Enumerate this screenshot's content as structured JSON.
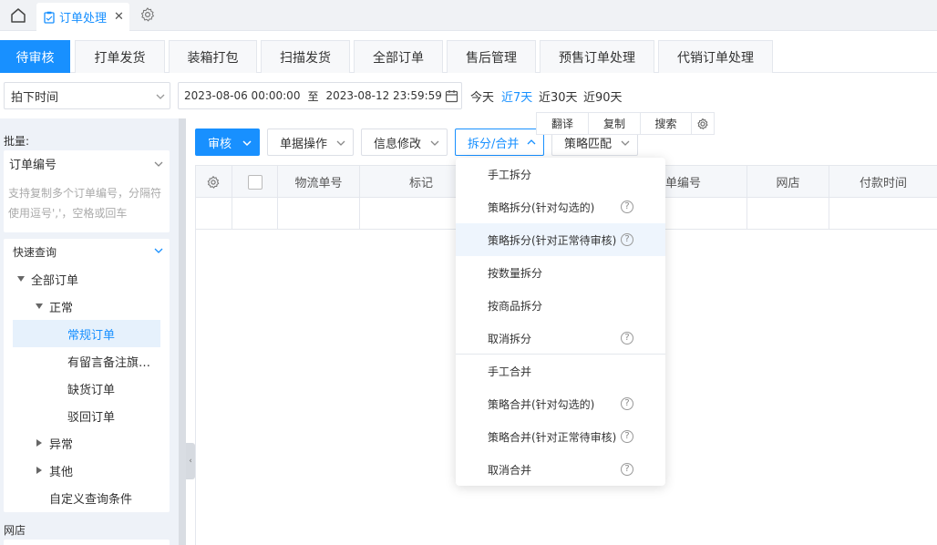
{
  "topbar": {
    "tab_title": "订单处理",
    "close_glyph": "✕"
  },
  "main_tabs": [
    "待审核",
    "打单发货",
    "装箱打包",
    "扫描发货",
    "全部订单",
    "售后管理",
    "预售订单处理",
    "代销订单处理"
  ],
  "filter": {
    "time_type": "拍下时间",
    "date_start": "2023-08-06 00:00:00",
    "date_sep": "至",
    "date_end": "2023-08-12 23:59:59",
    "quick_ranges": [
      "今天",
      "近7天",
      "近30天",
      "近90天"
    ],
    "active_quick_range": "近7天"
  },
  "left_panel": {
    "batch_label": "批量:",
    "batch_field": "订单编号",
    "batch_placeholder_line1": "支持复制多个订单编号，分隔符",
    "batch_placeholder_line2": "使用逗号','，空格或回车",
    "quick_query_title": "快速查询",
    "tree": {
      "all": "全部订单",
      "normal": "正常",
      "regular": "常规订单",
      "with_remarks": "有留言备注旗…",
      "out_of_stock": "缺货订单",
      "rejected": "驳回订单",
      "abnormal": "异常",
      "other": "其他",
      "custom_query": "自定义查询条件"
    },
    "shop_label": "网店"
  },
  "toolbar": {
    "audit": "审核",
    "single_ops": "单据操作",
    "info_edit": "信息修改",
    "split_merge": "拆分/合并",
    "strategy_match": "策略匹配"
  },
  "float_bar": {
    "translate": "翻译",
    "copy": "复制",
    "search": "搜索"
  },
  "table": {
    "headers": [
      "物流单号",
      "标记",
      "订单编号",
      "网店",
      "付款时间"
    ],
    "order_no_visible": "单编号"
  },
  "dropdown": {
    "items": [
      {
        "label": "手工拆分",
        "help": false
      },
      {
        "label": "策略拆分(针对勾选的)",
        "help": true
      },
      {
        "label": "策略拆分(针对正常待审核)",
        "help": true
      },
      {
        "label": "按数量拆分",
        "help": false
      },
      {
        "label": "按商品拆分",
        "help": false
      },
      {
        "label": "取消拆分",
        "help": true
      },
      {
        "label": "手工合并",
        "help": false
      },
      {
        "label": "策略合并(针对勾选的)",
        "help": true
      },
      {
        "label": "策略合并(针对正常待审核)",
        "help": true
      },
      {
        "label": "取消合并",
        "help": true
      }
    ],
    "help_glyph": "?"
  },
  "colors": {
    "primary": "#1890ff",
    "panel_bg": "#eef2f8",
    "hover_bg": "#eef5fd"
  }
}
